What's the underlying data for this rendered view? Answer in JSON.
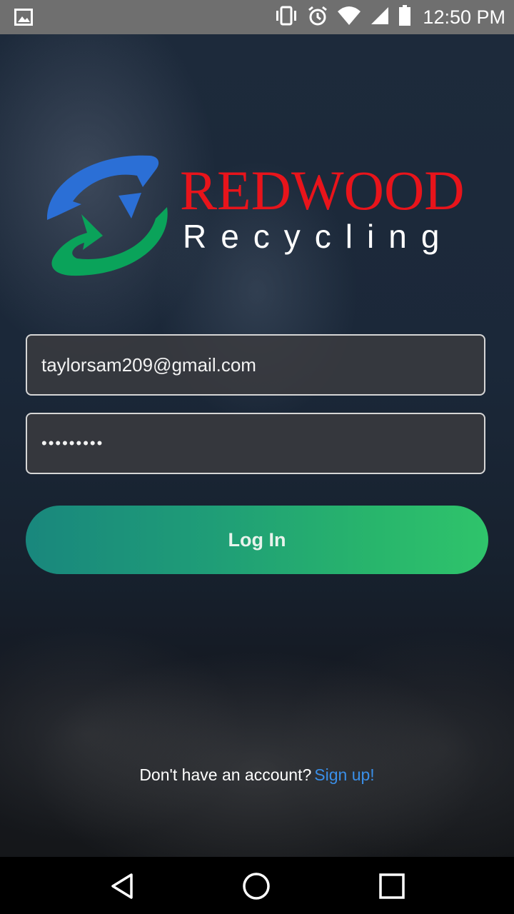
{
  "status_bar": {
    "time": "12:50 PM",
    "icons": [
      "image-notification-icon",
      "vibrate-icon",
      "alarm-icon",
      "wifi-icon",
      "signal-icon",
      "battery-icon"
    ]
  },
  "logo": {
    "brand_word": "REDWOOD",
    "sub_word": "Recycling",
    "colors": {
      "brand": "#e8141b",
      "arrow_blue": "#2b6fd6",
      "arrow_green": "#0aa35a"
    }
  },
  "login_form": {
    "email_value": "taylorsam209@gmail.com",
    "password_value": "•••••••••",
    "login_label": "Log In"
  },
  "signup": {
    "prompt": "Don't have an account?",
    "link": "Sign up!"
  },
  "nav_bar": {
    "buttons": [
      "back-icon",
      "home-icon",
      "recent-apps-icon"
    ]
  },
  "colors": {
    "status_bar": "#6f6f6f",
    "button_gradient_start": "#19877d",
    "button_gradient_end": "#2fc46b",
    "link": "#3a8fe8"
  }
}
